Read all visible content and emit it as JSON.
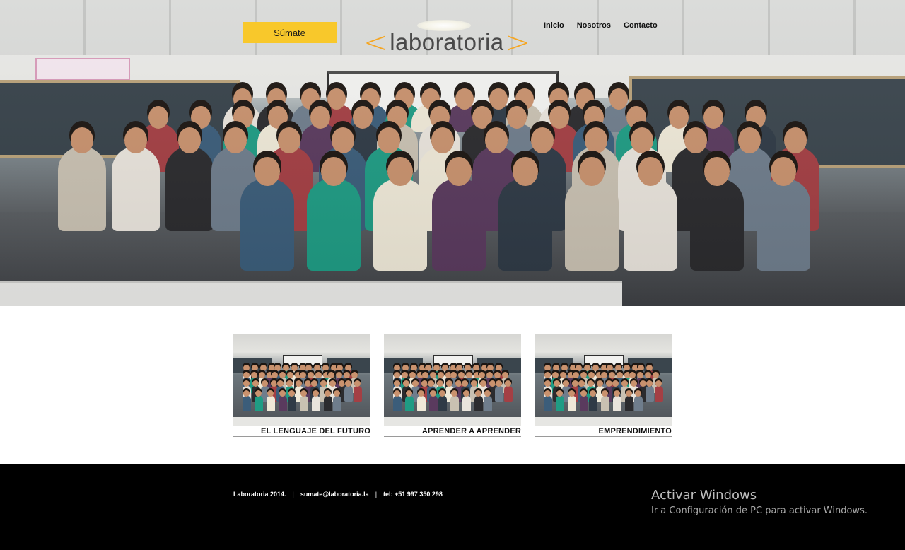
{
  "header": {
    "join_button": "Súmate",
    "logo": {
      "left": "<",
      "word": "laboratoria",
      "right": ">"
    },
    "nav": [
      "Inicio",
      "Nosotros",
      "Contacto"
    ]
  },
  "hero": {
    "image": "group-photo-classroom"
  },
  "cards": [
    {
      "caption": "EL LENGUAJE DEL FUTURO",
      "image": "group-photo-thumbnail"
    },
    {
      "caption": "APRENDER A APRENDER",
      "image": "group-photo-thumbnail"
    },
    {
      "caption": "EMPRENDIMIENTO",
      "image": "group-photo-thumbnail"
    }
  ],
  "footer": {
    "copyright": "Laboratoria 2014.",
    "separator": "|",
    "email": "sumate@laboratoria.la",
    "phone": "tel: +51 997 350 298"
  },
  "windows_watermark": {
    "title": "Activar Windows",
    "subtitle": "Ir a Configuración de PC para activar Windows."
  },
  "colors": {
    "accent": "#f8c82b",
    "logo_chevron": "#f5a623",
    "footer_bg": "#000000"
  }
}
